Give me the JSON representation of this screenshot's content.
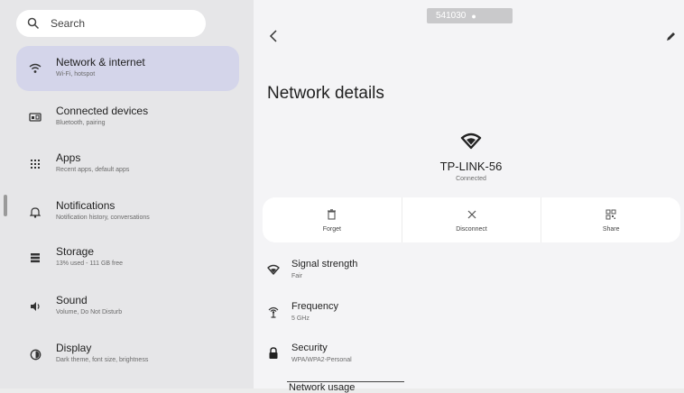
{
  "search": {
    "label": "Search"
  },
  "status_chip": {
    "text": "541030"
  },
  "sidebar": {
    "items": [
      {
        "title": "Network & internet",
        "sub": "Wi-Fi, hotspot",
        "icon": "wifi-icon",
        "active": true
      },
      {
        "title": "Connected devices",
        "sub": "Bluetooth, pairing",
        "icon": "connected-devices-icon"
      },
      {
        "title": "Apps",
        "sub": "Recent apps, default apps",
        "icon": "apps-grid-icon"
      },
      {
        "title": "Notifications",
        "sub": "Notification history, conversations",
        "icon": "bell-icon"
      },
      {
        "title": "Storage",
        "sub": "13% used - 111 GB free",
        "icon": "storage-icon"
      },
      {
        "title": "Sound",
        "sub": "Volume, Do Not Disturb",
        "icon": "speaker-icon"
      },
      {
        "title": "Display",
        "sub": "Dark theme, font size, brightness",
        "icon": "display-icon"
      }
    ]
  },
  "main": {
    "title": "Network details",
    "network_name": "TP-LINK-56",
    "network_status": "Connected",
    "actions": [
      {
        "label": "Forget",
        "icon": "trash-icon"
      },
      {
        "label": "Disconnect",
        "icon": "close-icon"
      },
      {
        "label": "Share",
        "icon": "qr-code-icon"
      }
    ],
    "details": [
      {
        "title": "Signal strength",
        "value": "Fair",
        "icon": "signal-icon"
      },
      {
        "title": "Frequency",
        "value": "5 GHz",
        "icon": "antenna-icon"
      },
      {
        "title": "Security",
        "value": "WPA/WPA2-Personal",
        "icon": "lock-icon"
      }
    ],
    "partial_row_title": "Network usage"
  },
  "colors": {
    "active_item_bg": "#d4d5ea",
    "sidebar_bg": "#e6e6e8",
    "main_bg": "#f4f4f6"
  }
}
